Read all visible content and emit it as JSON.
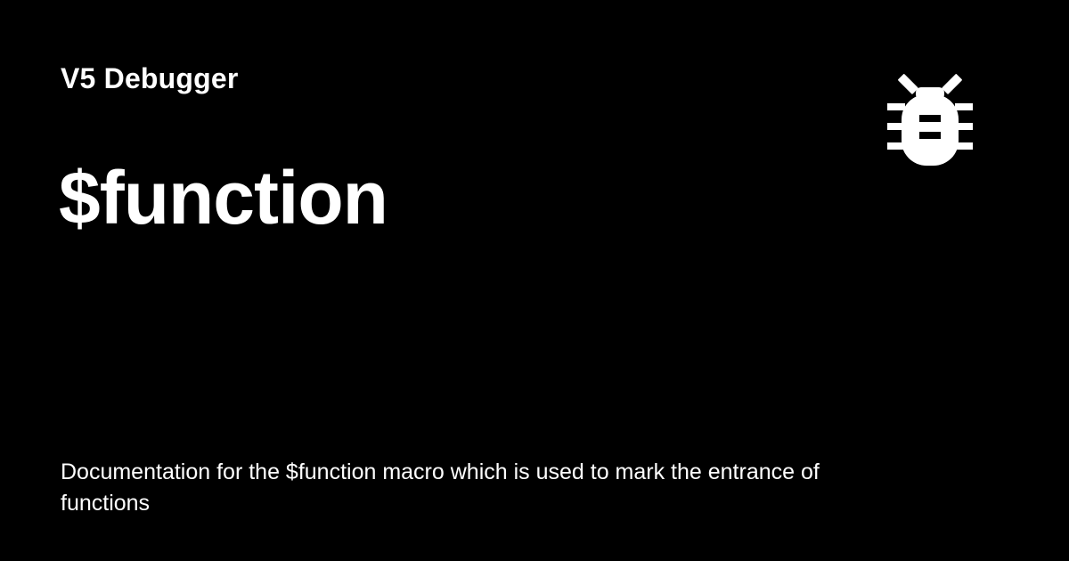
{
  "site": {
    "name": "V5 Debugger",
    "logo_icon": "bug-icon"
  },
  "page": {
    "title": "$function",
    "description": "Documentation for the $function macro which is used to mark the entrance of functions"
  },
  "colors": {
    "background": "#000000",
    "foreground": "#ffffff"
  }
}
